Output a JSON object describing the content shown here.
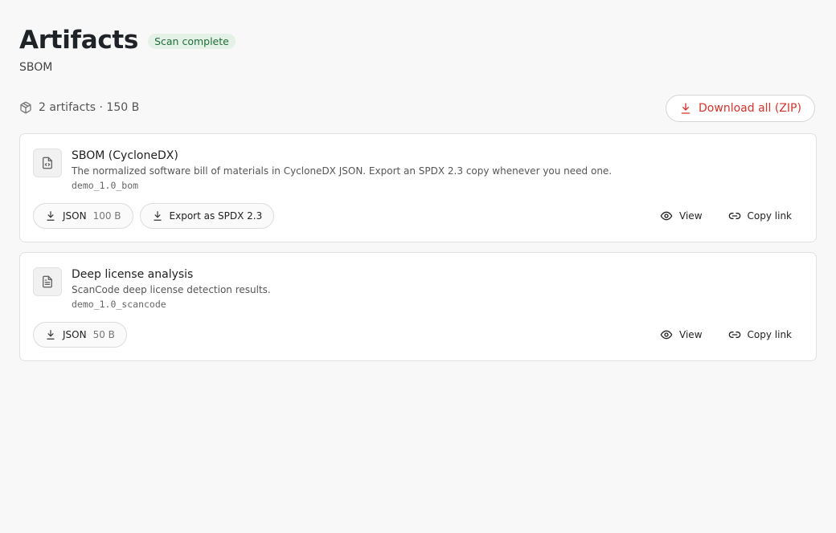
{
  "header": {
    "title": "Artifacts",
    "badge": "Scan complete",
    "subtitle": "SBOM"
  },
  "summary": {
    "text": "2 artifacts · 150 B",
    "icon": "package-icon",
    "download_all_label": "Download all (ZIP)",
    "download_icon": "download-icon"
  },
  "colors": {
    "accent": "#d2342c",
    "badge_bg": "#e3f1e6",
    "badge_text": "#216e39"
  },
  "artifacts": [
    {
      "name": "SBOM (CycloneDX)",
      "description": "The normalized software bill of materials in CycloneDX JSON. Export an SPDX 2.3 copy whenever you need one.",
      "key": "demo_1.0_bom",
      "icon": "file-code-icon",
      "json_label": "JSON",
      "size": "100 B",
      "export_label": "Export as SPDX 2.3",
      "view_label": "View",
      "copy_label": "Copy link"
    },
    {
      "name": "Deep license analysis",
      "description": "ScanCode deep license detection results.",
      "key": "demo_1.0_scancode",
      "icon": "file-text-icon",
      "json_label": "JSON",
      "size": "50 B",
      "view_label": "View",
      "copy_label": "Copy link"
    }
  ]
}
